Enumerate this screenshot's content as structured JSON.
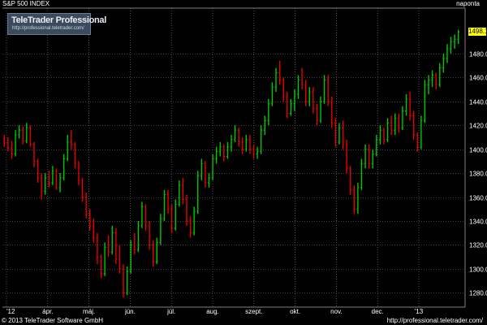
{
  "header": {
    "title": "S&P 500 INDEX",
    "period": "naponta"
  },
  "logo": {
    "name": "TeleTrader Professional",
    "url": "http://professional.teletrader.com/"
  },
  "last_price": "1498.11",
  "footer": {
    "copyright": "© 2013 TeleTrader Software GmbH",
    "url": "http://professional.teletrader.com/"
  },
  "colors": {
    "background": "#000000",
    "up_candle": "#00c800",
    "down_candle": "#e60000",
    "grid": "#808080",
    "accent": "#ffff00"
  },
  "chart_data": {
    "type": "ohlc",
    "title": "S&P 500 INDEX",
    "xlabel": "",
    "ylabel": "",
    "ylim": [
      1268,
      1518
    ],
    "y_ticks": [
      1280,
      1300,
      1320,
      1340,
      1360,
      1380,
      1400,
      1420,
      1440,
      1460,
      1480
    ],
    "x_ticks": [
      "'12",
      "ápr.",
      "máj.",
      "jún.",
      "júl.",
      "aug.",
      "szept.",
      "okt.",
      "nov.",
      "dec.",
      "'13"
    ],
    "grid": true,
    "series": [
      {
        "values": [
          [
            1409,
            1412,
            1402,
            1405
          ],
          [
            1405,
            1410,
            1398,
            1401
          ],
          [
            1401,
            1407,
            1392,
            1396
          ],
          [
            1396,
            1416,
            1394,
            1412
          ],
          [
            1412,
            1420,
            1409,
            1416
          ],
          [
            1416,
            1419,
            1404,
            1407
          ],
          [
            1407,
            1422,
            1405,
            1418
          ],
          [
            1418,
            1420,
            1402,
            1404
          ],
          [
            1404,
            1406,
            1385,
            1390
          ],
          [
            1390,
            1392,
            1372,
            1376
          ],
          [
            1376,
            1380,
            1358,
            1365
          ],
          [
            1365,
            1380,
            1362,
            1376
          ],
          [
            1376,
            1382,
            1368,
            1372
          ],
          [
            1372,
            1386,
            1370,
            1382
          ],
          [
            1382,
            1384,
            1366,
            1368
          ],
          [
            1368,
            1380,
            1364,
            1376
          ],
          [
            1376,
            1396,
            1374,
            1392
          ],
          [
            1392,
            1412,
            1390,
            1406
          ],
          [
            1406,
            1416,
            1400,
            1404
          ],
          [
            1404,
            1406,
            1384,
            1388
          ],
          [
            1388,
            1390,
            1370,
            1374
          ],
          [
            1374,
            1376,
            1356,
            1360
          ],
          [
            1360,
            1364,
            1342,
            1346
          ],
          [
            1346,
            1350,
            1332,
            1336
          ],
          [
            1336,
            1342,
            1322,
            1326
          ],
          [
            1326,
            1330,
            1304,
            1310
          ],
          [
            1310,
            1312,
            1292,
            1296
          ],
          [
            1296,
            1322,
            1294,
            1318
          ],
          [
            1318,
            1328,
            1310,
            1314
          ],
          [
            1314,
            1336,
            1312,
            1330
          ],
          [
            1330,
            1334,
            1304,
            1308
          ],
          [
            1308,
            1320,
            1296,
            1300
          ],
          [
            1300,
            1304,
            1276,
            1280
          ],
          [
            1280,
            1302,
            1278,
            1298
          ],
          [
            1298,
            1324,
            1296,
            1320
          ],
          [
            1320,
            1330,
            1312,
            1316
          ],
          [
            1316,
            1340,
            1314,
            1336
          ],
          [
            1336,
            1356,
            1334,
            1352
          ],
          [
            1352,
            1354,
            1332,
            1336
          ],
          [
            1336,
            1340,
            1316,
            1320
          ],
          [
            1320,
            1324,
            1302,
            1306
          ],
          [
            1306,
            1326,
            1304,
            1322
          ],
          [
            1322,
            1346,
            1320,
            1342
          ],
          [
            1342,
            1366,
            1340,
            1362
          ],
          [
            1362,
            1366,
            1346,
            1350
          ],
          [
            1350,
            1354,
            1330,
            1334
          ],
          [
            1334,
            1358,
            1332,
            1354
          ],
          [
            1354,
            1374,
            1352,
            1370
          ],
          [
            1370,
            1376,
            1354,
            1358
          ],
          [
            1358,
            1362,
            1336,
            1340
          ],
          [
            1340,
            1344,
            1326,
            1330
          ],
          [
            1330,
            1352,
            1328,
            1348
          ],
          [
            1348,
            1382,
            1346,
            1378
          ],
          [
            1378,
            1392,
            1374,
            1388
          ],
          [
            1388,
            1390,
            1368,
            1372
          ],
          [
            1372,
            1380,
            1368,
            1376
          ],
          [
            1376,
            1396,
            1374,
            1392
          ],
          [
            1392,
            1402,
            1388,
            1398
          ],
          [
            1398,
            1406,
            1394,
            1402
          ],
          [
            1402,
            1404,
            1390,
            1394
          ],
          [
            1394,
            1406,
            1392,
            1402
          ],
          [
            1402,
            1412,
            1398,
            1408
          ],
          [
            1408,
            1420,
            1406,
            1416
          ],
          [
            1416,
            1418,
            1402,
            1406
          ],
          [
            1406,
            1410,
            1396,
            1400
          ],
          [
            1400,
            1412,
            1398,
            1408
          ],
          [
            1408,
            1412,
            1396,
            1400
          ],
          [
            1400,
            1404,
            1392,
            1396
          ],
          [
            1396,
            1402,
            1392,
            1398
          ],
          [
            1398,
            1420,
            1396,
            1416
          ],
          [
            1416,
            1428,
            1412,
            1424
          ],
          [
            1424,
            1442,
            1420,
            1438
          ],
          [
            1438,
            1456,
            1436,
            1452
          ],
          [
            1452,
            1468,
            1448,
            1464
          ],
          [
            1464,
            1474,
            1454,
            1458
          ],
          [
            1458,
            1460,
            1440,
            1444
          ],
          [
            1444,
            1448,
            1426,
            1430
          ],
          [
            1430,
            1442,
            1428,
            1438
          ],
          [
            1438,
            1450,
            1432,
            1446
          ],
          [
            1446,
            1462,
            1442,
            1458
          ],
          [
            1458,
            1468,
            1450,
            1454
          ],
          [
            1454,
            1458,
            1436,
            1440
          ],
          [
            1440,
            1452,
            1436,
            1448
          ],
          [
            1448,
            1452,
            1430,
            1434
          ],
          [
            1434,
            1438,
            1420,
            1424
          ],
          [
            1424,
            1444,
            1422,
            1440
          ],
          [
            1440,
            1462,
            1438,
            1458
          ],
          [
            1458,
            1462,
            1436,
            1440
          ],
          [
            1440,
            1444,
            1418,
            1422
          ],
          [
            1422,
            1426,
            1402,
            1406
          ],
          [
            1406,
            1422,
            1404,
            1418
          ],
          [
            1418,
            1424,
            1400,
            1404
          ],
          [
            1404,
            1408,
            1380,
            1384
          ],
          [
            1384,
            1386,
            1362,
            1366
          ],
          [
            1366,
            1370,
            1346,
            1350
          ],
          [
            1350,
            1372,
            1346,
            1368
          ],
          [
            1368,
            1392,
            1366,
            1388
          ],
          [
            1388,
            1404,
            1384,
            1400
          ],
          [
            1400,
            1404,
            1384,
            1388
          ],
          [
            1388,
            1400,
            1384,
            1396
          ],
          [
            1396,
            1412,
            1394,
            1408
          ],
          [
            1408,
            1420,
            1404,
            1416
          ],
          [
            1416,
            1418,
            1404,
            1408
          ],
          [
            1408,
            1426,
            1406,
            1422
          ],
          [
            1422,
            1428,
            1412,
            1416
          ],
          [
            1416,
            1430,
            1412,
            1426
          ],
          [
            1426,
            1430,
            1414,
            1418
          ],
          [
            1418,
            1436,
            1416,
            1432
          ],
          [
            1432,
            1446,
            1428,
            1442
          ],
          [
            1442,
            1448,
            1424,
            1428
          ],
          [
            1428,
            1432,
            1408,
            1412
          ],
          [
            1412,
            1414,
            1398,
            1402
          ],
          [
            1402,
            1428,
            1400,
            1424
          ],
          [
            1424,
            1458,
            1422,
            1454
          ],
          [
            1454,
            1462,
            1446,
            1458
          ],
          [
            1458,
            1466,
            1452,
            1462
          ],
          [
            1462,
            1464,
            1450,
            1454
          ],
          [
            1454,
            1472,
            1452,
            1468
          ],
          [
            1468,
            1480,
            1464,
            1476
          ],
          [
            1476,
            1488,
            1472,
            1484
          ],
          [
            1484,
            1494,
            1480,
            1490
          ],
          [
            1490,
            1496,
            1484,
            1492
          ],
          [
            1492,
            1500,
            1488,
            1498
          ]
        ]
      }
    ]
  }
}
